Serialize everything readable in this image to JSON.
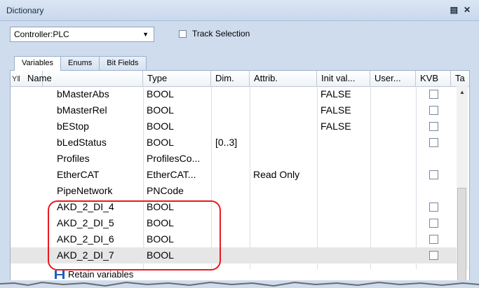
{
  "window": {
    "title": "Dictionary",
    "pin_icon": "pin-icon",
    "close_icon": "close-icon"
  },
  "toolbar": {
    "controller_value": "Controller:PLC",
    "track_label": "Track Selection"
  },
  "tabs": [
    {
      "label": "Variables",
      "active": true
    },
    {
      "label": "Enums",
      "active": false
    },
    {
      "label": "Bit Fields",
      "active": false
    }
  ],
  "columns": {
    "name": "Name",
    "type": "Type",
    "dim": "Dim.",
    "attrib": "Attrib.",
    "init": "Init val...",
    "user": "User...",
    "kvb": "KVB",
    "ta": "Ta"
  },
  "rows": [
    {
      "name": "bMasterAbs",
      "type": "BOOL",
      "dim": "",
      "attrib": "",
      "init": "FALSE",
      "kvb_checkbox": true
    },
    {
      "name": "bMasterRel",
      "type": "BOOL",
      "dim": "",
      "attrib": "",
      "init": "FALSE",
      "kvb_checkbox": true
    },
    {
      "name": "bEStop",
      "type": "BOOL",
      "dim": "",
      "attrib": "",
      "init": "FALSE",
      "kvb_checkbox": true
    },
    {
      "name": "bLedStatus",
      "type": "BOOL",
      "dim": "[0..3]",
      "attrib": "",
      "init": "",
      "kvb_checkbox": true
    },
    {
      "name": "Profiles",
      "type": "ProfilesCo...",
      "dim": "",
      "attrib": "",
      "init": "",
      "kvb_checkbox": false
    },
    {
      "name": "EtherCAT",
      "type": "EtherCAT...",
      "dim": "",
      "attrib": "Read Only",
      "init": "",
      "kvb_checkbox": true
    },
    {
      "name": "PipeNetwork",
      "type": "PNCode",
      "dim": "",
      "attrib": "",
      "init": "",
      "kvb_checkbox": false
    },
    {
      "name": "AKD_2_DI_4",
      "type": "BOOL",
      "dim": "",
      "attrib": "",
      "init": "",
      "kvb_checkbox": true
    },
    {
      "name": "AKD_2_DI_5",
      "type": "BOOL",
      "dim": "",
      "attrib": "",
      "init": "",
      "kvb_checkbox": true
    },
    {
      "name": "AKD_2_DI_6",
      "type": "BOOL",
      "dim": "",
      "attrib": "",
      "init": "",
      "kvb_checkbox": true
    },
    {
      "name": "AKD_2_DI_7",
      "type": "BOOL",
      "dim": "",
      "attrib": "",
      "init": "",
      "kvb_checkbox": true,
      "selected": true
    }
  ],
  "footer": {
    "label": "Retain variables",
    "icon": "retain-icon"
  },
  "colors": {
    "highlight": "#e8191f",
    "selected_row": "#e6e6e6"
  }
}
